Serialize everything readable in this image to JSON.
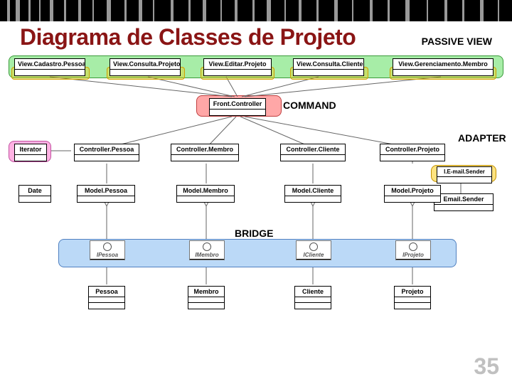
{
  "slide": {
    "title": "Diagrama de Classes de Projeto",
    "page_number": "35"
  },
  "patterns": {
    "passive_view": "PASSIVE VIEW",
    "command": "COMMAND",
    "adapter": "ADAPTER",
    "bridge": "BRIDGE"
  },
  "rows": {
    "views": [
      "View.Cadastro.Pessoa",
      "View.Consulta.Projeto",
      "View.Editar.Projeto",
      "View.Consulta.Cliente",
      "View.Gerenciamento.Membro"
    ],
    "front_controller": "Front.Controller",
    "iterator": "Iterator",
    "controllers": [
      "Controller.Pessoa",
      "Controller.Membro",
      "Controller.Cliente",
      "Controller.Projeto"
    ],
    "mail": {
      "interface": "I.E-mail.Sender",
      "impl": "Email.Sender"
    },
    "utils": {
      "date": "Date"
    },
    "models": [
      "Model.Pessoa",
      "Model.Membro",
      "Model.Cliente",
      "Model.Projeto"
    ],
    "interfaces": [
      "IPessoa",
      "IMembro",
      "ICliente",
      "IProjeto"
    ],
    "entities": [
      "Pessoa",
      "Membro",
      "Cliente",
      "Projeto"
    ]
  }
}
